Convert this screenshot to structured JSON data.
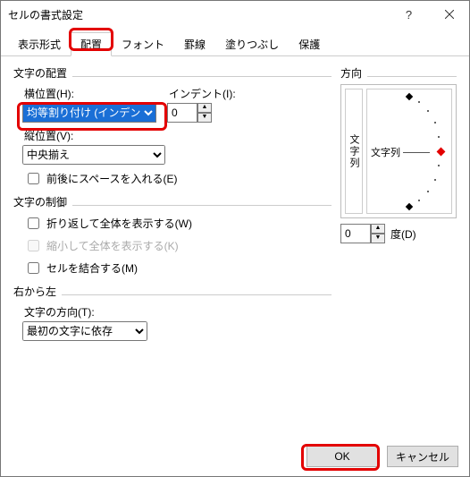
{
  "window": {
    "title": "セルの書式設定"
  },
  "tabs": {
    "display": "表示形式",
    "alignment": "配置",
    "font": "フォント",
    "border": "罫線",
    "fill": "塗りつぶし",
    "protection": "保護",
    "active": "alignment"
  },
  "alignment": {
    "group": "文字の配置",
    "horizontal_label": "横位置(H):",
    "horizontal_value": "均等割り付け (インデント)",
    "indent_label": "インデント(I):",
    "indent_value": "0",
    "vertical_label": "縦位置(V):",
    "vertical_value": "中央揃え",
    "space_check": "前後にスペースを入れる(E)"
  },
  "control": {
    "group": "文字の制御",
    "wrap": "折り返して全体を表示する(W)",
    "shrink": "縮小して全体を表示する(K)",
    "merge": "セルを結合する(M)"
  },
  "rtl": {
    "group": "右から左",
    "dir_label": "文字の方向(T):",
    "dir_value": "最初の文字に依存"
  },
  "orientation": {
    "group": "方向",
    "vertical_text": "文字列",
    "main_text": "文字列",
    "degree_value": "0",
    "degree_label": "度(D)"
  },
  "buttons": {
    "ok": "OK",
    "cancel": "キャンセル"
  }
}
